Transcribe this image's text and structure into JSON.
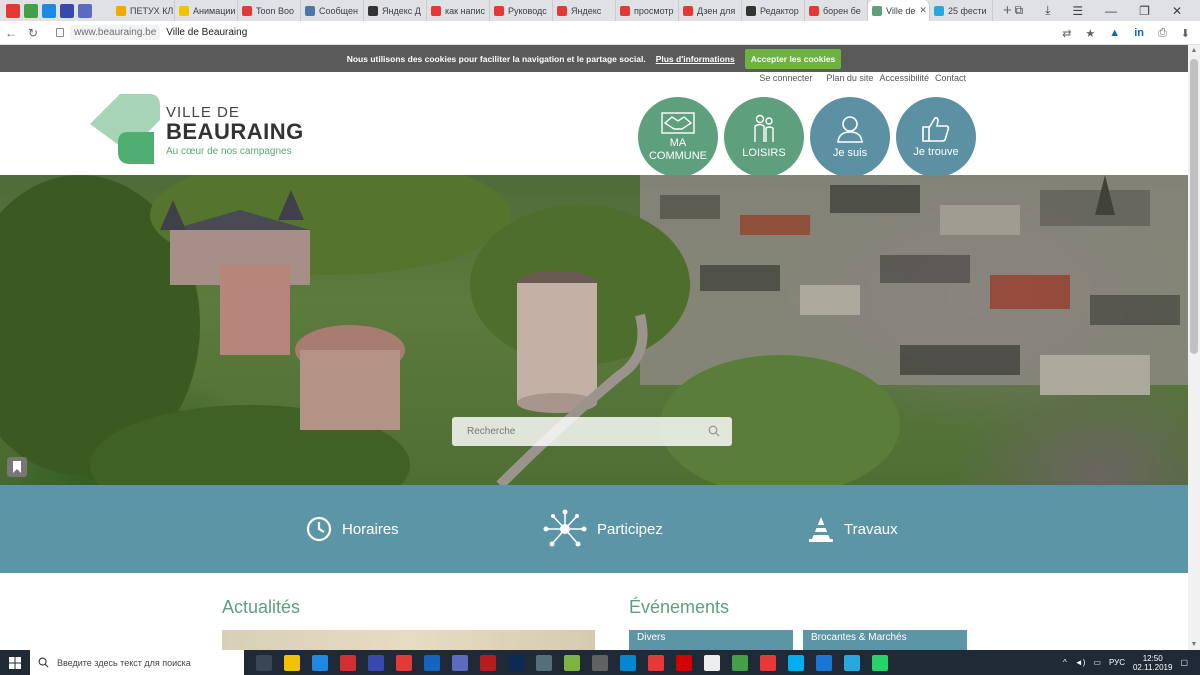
{
  "browser": {
    "tabs": [
      {
        "label": "ПЕТУХ КЛ",
        "color": "#f2a900"
      },
      {
        "label": "Анимации",
        "color": "#f2c200"
      },
      {
        "label": "Toon Boo",
        "color": "#e53935"
      },
      {
        "label": "Сообщен",
        "color": "#4a76a8"
      },
      {
        "label": "Яндекс Д",
        "color": "#333333"
      },
      {
        "label": "как напис",
        "color": "#e53935"
      },
      {
        "label": "Руководс",
        "color": "#e53935"
      },
      {
        "label": "Яндекс",
        "color": "#e53935"
      },
      {
        "label": "просмотр",
        "color": "#e53935"
      },
      {
        "label": "Дзен для",
        "color": "#e53935"
      },
      {
        "label": "Редактор",
        "color": "#333333"
      },
      {
        "label": "борен бе",
        "color": "#e53935"
      },
      {
        "label": "Ville de",
        "color": "#5e9f7d",
        "active": true
      },
      {
        "label": "25 фести",
        "color": "#29a8e0"
      }
    ],
    "new_tab": "+",
    "url_host": "www.beauraing.be",
    "page_title": "Ville de Beauraing"
  },
  "cookie": {
    "message": "Nous utilisons des cookies pour faciliter la navigation et le partage social.",
    "more_link": "Plus d'informations",
    "accept_label": "Accepter les cookies"
  },
  "header": {
    "top_links": [
      "Se connecter",
      "Plan du site",
      "Accessibilité",
      "Contact"
    ],
    "logo_small": "VILLE DE",
    "logo_big": "BEAURAING",
    "logo_tagline": "Au cœur de nos campagnes",
    "circles": [
      {
        "label_line1": "MA",
        "label_line2": "COMMUNE",
        "icon": "handshake-icon",
        "color": "#5e9f7d"
      },
      {
        "label_line1": "LOISIRS",
        "label_line2": "",
        "icon": "family-icon",
        "color": "#5e9f7d"
      },
      {
        "label_line1": "Je suis",
        "label_line2": "",
        "icon": "user-icon",
        "color": "#5c91a3"
      },
      {
        "label_line1": "Je trouve",
        "label_line2": "",
        "icon": "thumbs-up-icon",
        "color": "#5c91a3"
      }
    ]
  },
  "hero": {
    "search_placeholder": "Recherche"
  },
  "quicklinks": [
    {
      "label": "Horaires",
      "icon": "clock-icon"
    },
    {
      "label": "Participez",
      "icon": "network-icon"
    },
    {
      "label": "Travaux",
      "icon": "traffic-cone-icon"
    }
  ],
  "news": {
    "title": "Actualités"
  },
  "events": {
    "title": "Événements",
    "cards": [
      "Divers",
      "Brocantes & Marchés"
    ]
  },
  "taskbar": {
    "search_placeholder": "Введите здесь текст для поиска",
    "lang": "РУС",
    "time": "12:50",
    "date": "02.11.2019"
  },
  "colors": {
    "green": "#5e9f7d",
    "teal": "#5c95a6",
    "cookie_bg": "#5a5a5a",
    "accept_btn": "#6db33f"
  }
}
